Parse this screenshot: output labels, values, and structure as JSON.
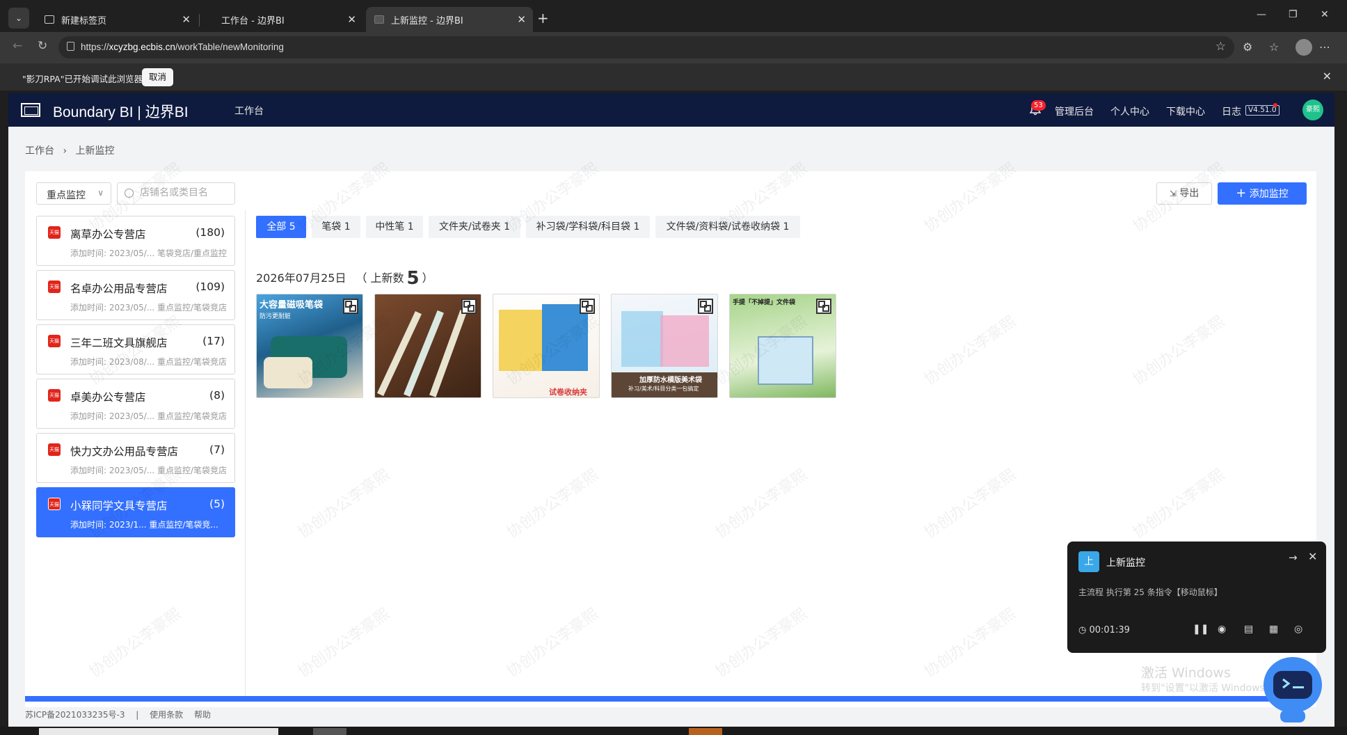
{
  "browser": {
    "tabs": [
      {
        "title": "新建标签页"
      },
      {
        "title": "工作台 - 边界BI"
      },
      {
        "title": "上新监控 - 边界BI"
      }
    ],
    "url_prefix": "https://",
    "url_host": "xcyzbg.ecbis.cn",
    "url_path": "/workTable/newMonitoring",
    "infobar_message": "\"影刀RPA\"已开始调试此浏览器",
    "infobar_cancel": "取消"
  },
  "app": {
    "brand": "Boundary BI | 边界BI",
    "nav_workbench": "工作台",
    "notification_count": "53",
    "admin": "管理后台",
    "personal": "个人中心",
    "download": "下载中心",
    "log": "日志",
    "version": "V4.51.0",
    "user_initials": "豪熙"
  },
  "breadcrumb": {
    "home": "工作台",
    "current": "上新监控"
  },
  "toolbar": {
    "filter_value": "重点监控",
    "search_placeholder": "店铺名或类目名",
    "export_label": "导出",
    "add_label": "添加监控"
  },
  "shops": [
    {
      "badge": "天猫",
      "name": "离草办公专营店",
      "count": "(180)",
      "meta": "添加时间: 2023/05/... 笔袋竞店/重点监控"
    },
    {
      "badge": "天猫",
      "name": "名卓办公用品专营店",
      "count": "(109)",
      "meta": "添加时间: 2023/05/... 重点监控/笔袋竞店"
    },
    {
      "badge": "天猫",
      "name": "三年二班文具旗舰店",
      "count": "(17)",
      "meta": "添加时间: 2023/08/... 重点监控/笔袋竞店"
    },
    {
      "badge": "天猫",
      "name": "卓美办公专营店",
      "count": "(8)",
      "meta": "添加时间: 2023/05/... 重点监控/笔袋竞店"
    },
    {
      "badge": "天猫",
      "name": "快力文办公用品专营店",
      "count": "(7)",
      "meta": "添加时间: 2023/05/... 重点监控/笔袋竞店"
    },
    {
      "badge": "天猫",
      "name": "小槑同学文具专营店",
      "count": "(5)",
      "meta": "添加时间: 2023/1... 重点监控/笔袋竞..."
    }
  ],
  "categories": [
    {
      "label": "全部 5"
    },
    {
      "label": "笔袋 1"
    },
    {
      "label": "中性笔 1"
    },
    {
      "label": "文件夹/试卷夹 1"
    },
    {
      "label": "补习袋/学科袋/科目袋 1"
    },
    {
      "label": "文件袋/资料袋/试卷收纳袋 1"
    }
  ],
  "day": {
    "date": "2026年07月25日",
    "label_open": "（ 上新数",
    "count": "5",
    "label_close": "）"
  },
  "products": [
    {
      "text": "大容量磁吸笔袋",
      "sub": "防污更耐脏",
      "colors": [
        "#4aa3df",
        "#1f5f8b"
      ]
    },
    {
      "text": "",
      "sub": "",
      "colors": [
        "#6b3b22",
        "#d9c7a8"
      ]
    },
    {
      "text": "试卷收纳夹",
      "sub": "",
      "colors": [
        "#f4d35e",
        "#e86a5a"
      ]
    },
    {
      "text": "加厚防水横版美术袋",
      "sub": "补习/美术/科目分类一包搞定",
      "colors": [
        "#9dd3f0",
        "#f2a2c0"
      ]
    },
    {
      "text": "手提「不掉提」文件袋",
      "sub": "",
      "colors": [
        "#8cc56f",
        "#cfe8f5"
      ]
    }
  ],
  "footer": {
    "icp": "苏ICP备2021033235号-3",
    "terms": "使用条款",
    "help": "帮助"
  },
  "watermark": "协创办公李豪熙",
  "rpa": {
    "icon_char": "上",
    "title": "上新监控",
    "step": "主流程 执行第 25 条指令【移动鼠标】",
    "timer": "00:01:39"
  },
  "windows_activate": {
    "title": "激活 Windows",
    "sub": "转到\"设置\"以激活 Windows。"
  }
}
